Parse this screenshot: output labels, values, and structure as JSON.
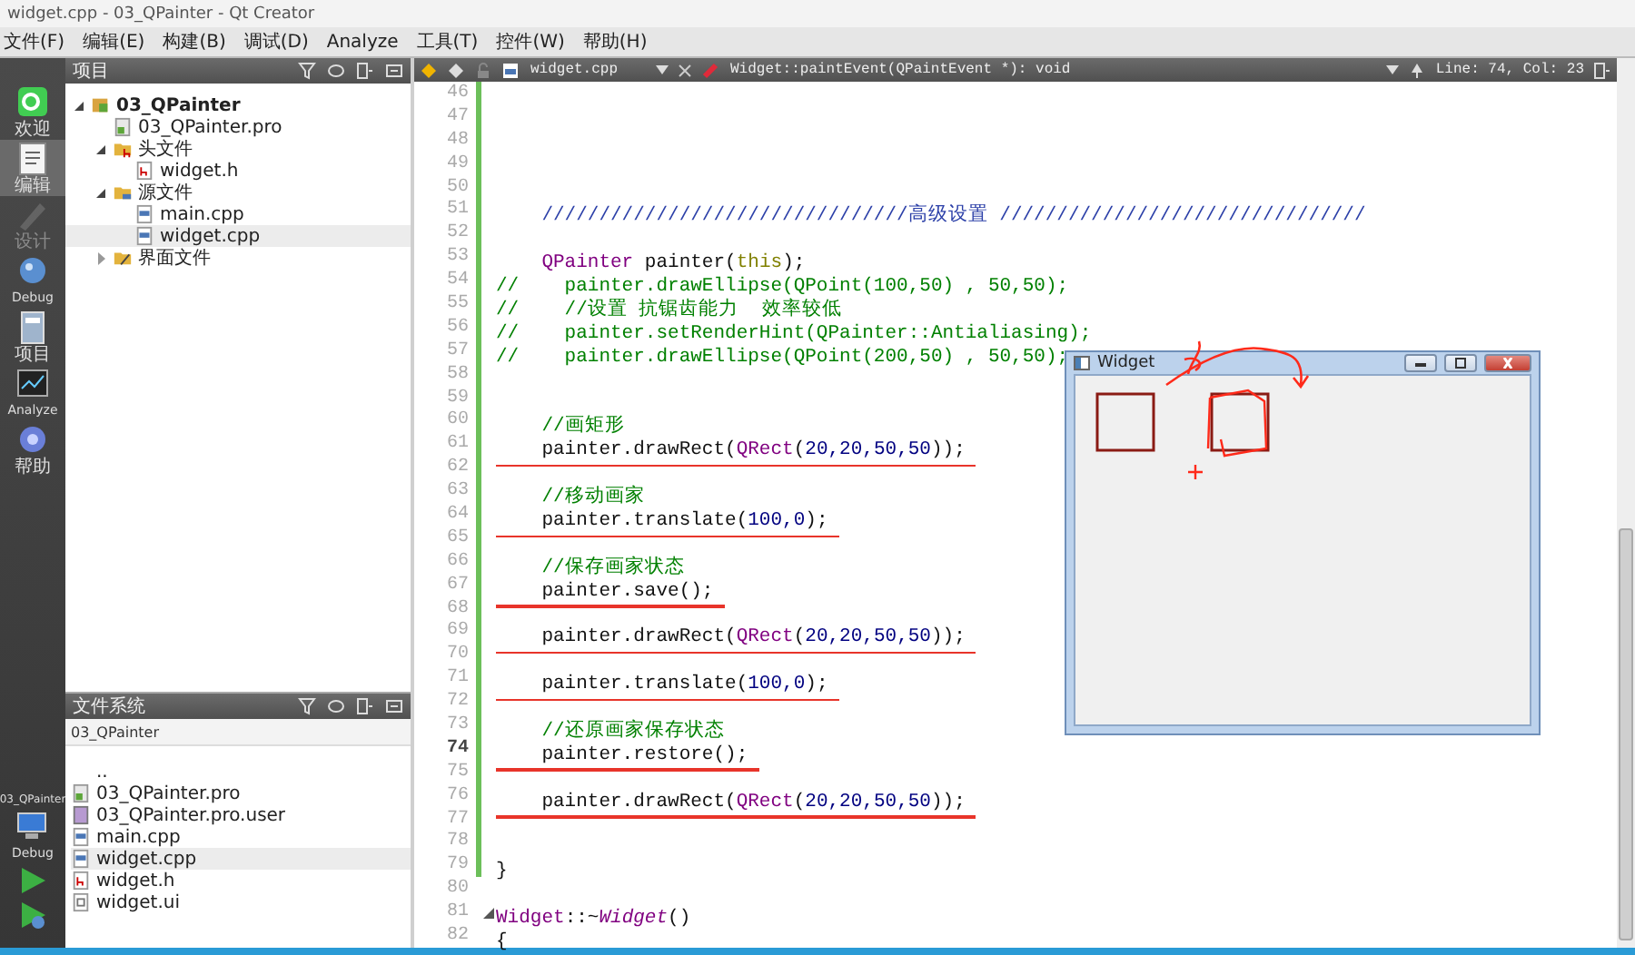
{
  "window": {
    "title": "widget.cpp - 03_QPainter - Qt Creator"
  },
  "menu": [
    "文件(F)",
    "编辑(E)",
    "构建(B)",
    "调试(D)",
    "Analyze",
    "工具(T)",
    "控件(W)",
    "帮助(H)"
  ],
  "modes": [
    {
      "label": "欢迎",
      "kind": "welcome",
      "selected": false,
      "disabled": false
    },
    {
      "label": "编辑",
      "kind": "edit",
      "selected": true,
      "disabled": false
    },
    {
      "label": "设计",
      "kind": "design",
      "selected": false,
      "disabled": true
    },
    {
      "label": "Debug",
      "kind": "debug",
      "selected": false,
      "disabled": false
    },
    {
      "label": "项目",
      "kind": "projects",
      "selected": false,
      "disabled": false
    },
    {
      "label": "Analyze",
      "kind": "analyze",
      "selected": false,
      "disabled": false
    },
    {
      "label": "帮助",
      "kind": "help",
      "selected": false,
      "disabled": false
    }
  ],
  "run_target": {
    "project": "03_QPainter",
    "config": "Debug"
  },
  "projects_panel": {
    "title": "项目",
    "tree": [
      {
        "label": "03_QPainter",
        "kind": "project",
        "expanded": true,
        "selected": false,
        "children": [
          {
            "label": "03_QPainter.pro",
            "kind": "pro",
            "selected": false
          },
          {
            "label": "头文件",
            "kind": "folder-h",
            "expanded": true,
            "selected": false,
            "children": [
              {
                "label": "widget.h",
                "kind": "header",
                "selected": false
              }
            ]
          },
          {
            "label": "源文件",
            "kind": "folder-src",
            "expanded": true,
            "selected": false,
            "children": [
              {
                "label": "main.cpp",
                "kind": "source",
                "selected": false
              },
              {
                "label": "widget.cpp",
                "kind": "source",
                "selected": true
              }
            ]
          },
          {
            "label": "界面文件",
            "kind": "folder-ui",
            "expanded": false,
            "selected": false
          }
        ]
      }
    ]
  },
  "file_system_panel": {
    "title": "文件系统",
    "path": "03_QPainter",
    "files": [
      {
        "name": "..",
        "kind": "up",
        "selected": false
      },
      {
        "name": "03_QPainter.pro",
        "kind": "pro",
        "selected": false
      },
      {
        "name": "03_QPainter.pro.user",
        "kind": "user",
        "selected": false
      },
      {
        "name": "main.cpp",
        "kind": "source",
        "selected": false
      },
      {
        "name": "widget.cpp",
        "kind": "source",
        "selected": true
      },
      {
        "name": "widget.h",
        "kind": "header",
        "selected": false
      },
      {
        "name": "widget.ui",
        "kind": "ui",
        "selected": false
      }
    ]
  },
  "editor": {
    "file": "widget.cpp",
    "symbol": "Widget::paintEvent(QPaintEvent *): void",
    "position": "Line: 74, Col: 23",
    "lines": [
      {
        "number": "46",
        "current": false,
        "modified": true
      },
      {
        "number": "47",
        "current": false,
        "modified": true
      },
      {
        "number": "48",
        "current": false,
        "modified": true
      },
      {
        "number": "49",
        "current": false,
        "modified": true
      },
      {
        "number": "50",
        "current": false,
        "modified": true
      },
      {
        "number": "51",
        "segments": [
          {
            "kind": "doc",
            "text": "    ////////////////////////////////高级设置 ////////////////////////////////"
          }
        ],
        "underlined": false,
        "current": false,
        "modified": true
      },
      {
        "number": "52",
        "current": false,
        "modified": true
      },
      {
        "number": "53",
        "segments": [
          {
            "kind": "type",
            "text": "    QPainter"
          },
          {
            "kind": "plain",
            "text": " painter("
          },
          {
            "kind": "keyword",
            "text": "this"
          },
          {
            "kind": "plain",
            "text": ");"
          }
        ],
        "underlined": false,
        "current": false,
        "modified": true
      },
      {
        "number": "54",
        "segments": [
          {
            "kind": "comment",
            "text": "//    painter.drawEllipse(QPoint(100,50) , 50,50);"
          }
        ],
        "underlined": false,
        "current": false,
        "modified": true
      },
      {
        "number": "55",
        "segments": [
          {
            "kind": "comment",
            "text": "//    //设置 抗锯齿能力  效率较低"
          }
        ],
        "underlined": false,
        "current": false,
        "modified": true
      },
      {
        "number": "56",
        "segments": [
          {
            "kind": "comment",
            "text": "//    painter.setRenderHint(QPainter::Antialiasing);"
          }
        ],
        "underlined": false,
        "current": false,
        "modified": true
      },
      {
        "number": "57",
        "segments": [
          {
            "kind": "comment",
            "text": "//    painter.drawEllipse(QPoint(200,50) , 50,50);"
          }
        ],
        "underlined": false,
        "current": false,
        "modified": true
      },
      {
        "number": "58",
        "current": false,
        "modified": true
      },
      {
        "number": "59",
        "current": false,
        "modified": true
      },
      {
        "number": "60",
        "segments": [
          {
            "kind": "comment",
            "text": "    //画矩形"
          }
        ],
        "underlined": false,
        "current": false,
        "modified": true
      },
      {
        "number": "61",
        "segments": [
          {
            "kind": "plain",
            "text": "    painter.drawRect("
          },
          {
            "kind": "type",
            "text": "QRect"
          },
          {
            "kind": "plain",
            "text": "("
          },
          {
            "kind": "number",
            "text": "20,20,50,50"
          },
          {
            "kind": "plain",
            "text": "));"
          }
        ],
        "underlined": true,
        "current": false,
        "modified": true
      },
      {
        "number": "62",
        "current": false,
        "modified": true
      },
      {
        "number": "63",
        "segments": [
          {
            "kind": "comment",
            "text": "    //移动画家"
          }
        ],
        "underlined": false,
        "current": false,
        "modified": true
      },
      {
        "number": "64",
        "segments": [
          {
            "kind": "plain",
            "text": "    painter.translate("
          },
          {
            "kind": "number",
            "text": "100,0"
          },
          {
            "kind": "plain",
            "text": ");"
          }
        ],
        "underlined": true,
        "current": false,
        "modified": true
      },
      {
        "number": "65",
        "current": false,
        "modified": true
      },
      {
        "number": "66",
        "segments": [
          {
            "kind": "comment",
            "text": "    //保存画家状态"
          }
        ],
        "underlined": false,
        "current": false,
        "modified": true
      },
      {
        "number": "67",
        "segments": [
          {
            "kind": "plain",
            "text": "    painter.save();"
          }
        ],
        "underlined": true,
        "current": false,
        "modified": true
      },
      {
        "number": "68",
        "current": false,
        "modified": true
      },
      {
        "number": "69",
        "segments": [
          {
            "kind": "plain",
            "text": "    painter.drawRect("
          },
          {
            "kind": "type",
            "text": "QRect"
          },
          {
            "kind": "plain",
            "text": "("
          },
          {
            "kind": "number",
            "text": "20,20,50,50"
          },
          {
            "kind": "plain",
            "text": "));"
          }
        ],
        "underlined": true,
        "current": false,
        "modified": true
      },
      {
        "number": "70",
        "current": false,
        "modified": true
      },
      {
        "number": "71",
        "segments": [
          {
            "kind": "plain",
            "text": "    painter.translate("
          },
          {
            "kind": "number",
            "text": "100,0"
          },
          {
            "kind": "plain",
            "text": ");"
          }
        ],
        "underlined": true,
        "current": false,
        "modified": true
      },
      {
        "number": "72",
        "current": false,
        "modified": true
      },
      {
        "number": "73",
        "segments": [
          {
            "kind": "comment",
            "text": "    //还原画家保存状态"
          }
        ],
        "underlined": false,
        "current": false,
        "modified": true
      },
      {
        "number": "74",
        "segments": [
          {
            "kind": "plain",
            "text": "    painter.restore();"
          }
        ],
        "underlined": true,
        "current": true,
        "modified": true
      },
      {
        "number": "75",
        "current": false,
        "modified": true
      },
      {
        "number": "76",
        "segments": [
          {
            "kind": "plain",
            "text": "    painter.drawRect("
          },
          {
            "kind": "type",
            "text": "QRect"
          },
          {
            "kind": "plain",
            "text": "("
          },
          {
            "kind": "number",
            "text": "20,20,50,50"
          },
          {
            "kind": "plain",
            "text": "));"
          }
        ],
        "underlined": true,
        "current": false,
        "modified": true
      },
      {
        "number": "77",
        "current": false,
        "modified": true
      },
      {
        "number": "78",
        "current": false,
        "modified": true
      },
      {
        "number": "79",
        "segments": [
          {
            "kind": "plain",
            "text": "}"
          }
        ],
        "underlined": false,
        "current": false,
        "modified": true
      },
      {
        "number": "80",
        "current": false,
        "modified": false
      },
      {
        "number": "81",
        "segments": [
          {
            "kind": "type",
            "text": "Widget"
          },
          {
            "kind": "plain",
            "text": "::~"
          },
          {
            "kind": "italic",
            "text": "Widget"
          },
          {
            "kind": "plain",
            "text": "()"
          }
        ],
        "underlined": false,
        "current": false,
        "modified": false,
        "foldable": true
      },
      {
        "number": "82",
        "segments": [
          {
            "kind": "plain",
            "text": "{"
          }
        ],
        "underlined": false,
        "current": false,
        "modified": false
      }
    ]
  },
  "widget_window": {
    "title": "Widget"
  }
}
